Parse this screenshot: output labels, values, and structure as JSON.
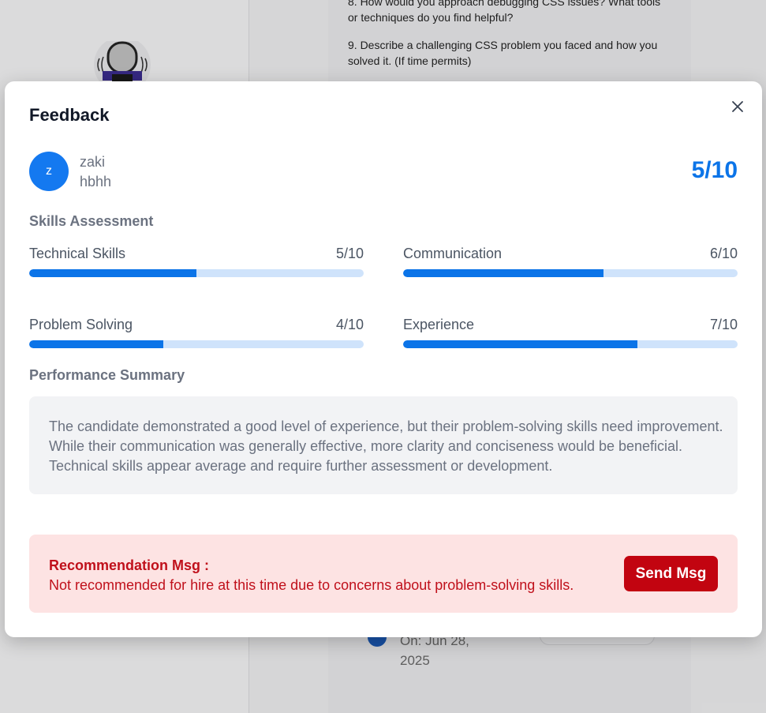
{
  "background": {
    "questions": [
      "8. How would you approach debugging CSS issues? What tools or techniques do you find helpful?",
      "9. Describe a challenging CSS problem you faced and how you solved it. (If time permits)"
    ],
    "date_text": "On: Jun 28, 2025",
    "logo_icon": "podcast-microphone-logo-icon"
  },
  "modal": {
    "title": "Feedback",
    "close_icon": "close-icon",
    "candidate": {
      "initial": "z",
      "name": "zaki",
      "role": "hbhh"
    },
    "overall_score": "5/10",
    "skills_heading": "Skills Assessment",
    "skills": [
      {
        "label": "Technical Skills",
        "score": "5/10",
        "fraction": 0.5
      },
      {
        "label": "Communication",
        "score": "6/10",
        "fraction": 0.6
      },
      {
        "label": "Problem Solving",
        "score": "4/10",
        "fraction": 0.4
      },
      {
        "label": "Experience",
        "score": "7/10",
        "fraction": 0.7
      }
    ],
    "summary_heading": "Performance Summary",
    "summary_text": "The candidate demonstrated a good level of experience, but their problem-solving skills need improvement. While their communication was generally effective, more clarity and conciseness would be beneficial. Technical skills appear average and require further assessment or development.",
    "recommendation": {
      "title": "Recommendation Msg :",
      "text": "Not recommended for hire at this time due to concerns about problem-solving skills.",
      "button_label": "Send Msg"
    }
  },
  "colors": {
    "accent": "#0b74e8",
    "track": "#cfe3fb",
    "danger": "#c20410",
    "danger_bg": "#fde3e3"
  }
}
